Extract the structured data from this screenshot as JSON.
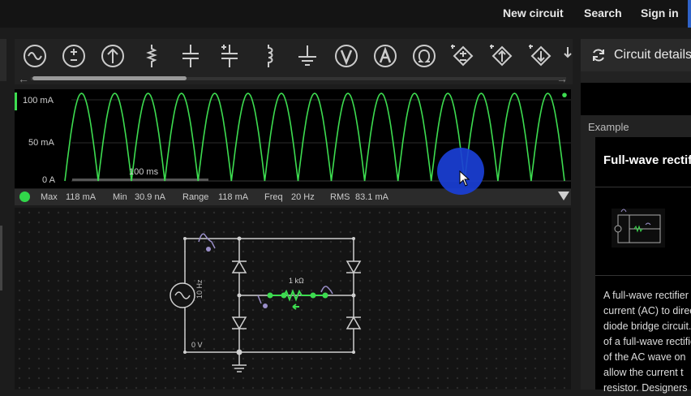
{
  "nav": {
    "new_circuit": "New circuit",
    "search": "Search",
    "sign_in": "Sign in"
  },
  "toolbar": {
    "tools": [
      {
        "name": "ac-source-icon"
      },
      {
        "name": "dc-source-icon"
      },
      {
        "name": "current-source-icon"
      },
      {
        "name": "resistor-icon"
      },
      {
        "name": "capacitor-icon"
      },
      {
        "name": "polarized-capacitor-icon"
      },
      {
        "name": "inductor-icon"
      },
      {
        "name": "ground-icon"
      },
      {
        "name": "voltmeter-icon"
      },
      {
        "name": "ammeter-icon"
      },
      {
        "name": "ohmmeter-icon"
      },
      {
        "name": "dependent-voltage-source-icon"
      },
      {
        "name": "dependent-current-source-icon"
      },
      {
        "name": "dependent-source-icon"
      }
    ],
    "scroll_left": "←",
    "scroll_right": "→"
  },
  "scope": {
    "y_labels": [
      "100 mA",
      "50 mA",
      "0 A"
    ],
    "time_label": "100 ms",
    "trace_color": "#3ddc50"
  },
  "chart_data": {
    "type": "line",
    "title": "",
    "xlabel": "",
    "ylabel": "",
    "ylim": [
      0,
      118
    ],
    "x_unit": "ms",
    "series": [
      {
        "name": "",
        "x": [
          0,
          21,
          42,
          63,
          84,
          105,
          126,
          147,
          168,
          189,
          210,
          231,
          252,
          273,
          294,
          315,
          336,
          357,
          378,
          399,
          420,
          441,
          462,
          483,
          504,
          525,
          546,
          567,
          588,
          609,
          630
        ],
        "values": [
          0,
          118,
          0,
          118,
          0,
          118,
          0,
          118,
          0,
          118,
          0,
          118,
          0,
          118,
          0,
          118,
          0,
          118,
          0,
          118,
          0,
          118,
          0,
          118,
          0,
          118,
          0,
          118,
          0,
          118,
          0
        ]
      }
    ]
  },
  "status": {
    "max_label": "Max",
    "max_value": "118 mA",
    "min_label": "Min",
    "min_value": "30.9 nA",
    "range_label": "Range",
    "range_value": "118 mA",
    "freq_label": "Freq",
    "freq_value": "20 Hz",
    "rms_label": "RMS",
    "rms_value": "83.1 mA"
  },
  "circuit": {
    "source_label": "10 Hz",
    "resistor_label": "1 kΩ",
    "ground_label": "0 V"
  },
  "panel": {
    "title": "Circuit details",
    "example_label": "Example",
    "card_title": "Full-wave rectifier",
    "description_lines": [
      "A full-wave rectifier converts alternating",
      "current (AC) to direct current (DC) using a",
      "diode bridge circuit. The output",
      "of a full-wave rectifier",
      "of the AC wave on",
      "allow the current t",
      "resistor. Designers"
    ]
  }
}
